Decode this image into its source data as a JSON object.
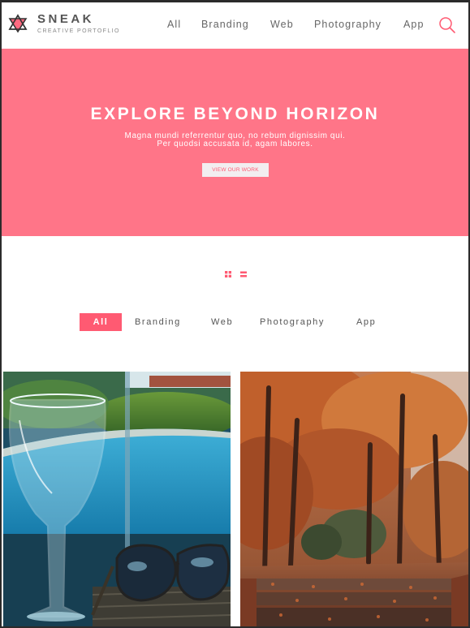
{
  "brand": {
    "name": "SNEAK",
    "tagline": "CREATIVE PORTOFLIO",
    "logo_icon": "hexagram-logo-icon"
  },
  "nav": {
    "items": [
      "All",
      "Branding",
      "Web",
      "Photography",
      "App"
    ],
    "search_icon": "search-icon"
  },
  "hero": {
    "title": "EXPLORE BEYOND HORIZON",
    "subtitle_line1": "Magna mundi referrentur quo, no rebum dignissim qui.",
    "subtitle_line2": "Per quodsi accusata id, agam labores.",
    "cta_label": "VIEW OUR WORK"
  },
  "view_toggles": {
    "grid_icon": "grid-view-icon",
    "list_icon": "list-view-icon"
  },
  "filter": {
    "items": [
      "All",
      "Branding",
      "Web",
      "Photography",
      "App"
    ],
    "active": "All"
  },
  "colors": {
    "accent": "#ff5a72",
    "hero_bg": "#ff7588",
    "nav_text": "#666666"
  },
  "gallery": [
    {
      "subject": "wine glass and sunglasses by a pool"
    },
    {
      "subject": "autumn trees over stone steps"
    }
  ]
}
